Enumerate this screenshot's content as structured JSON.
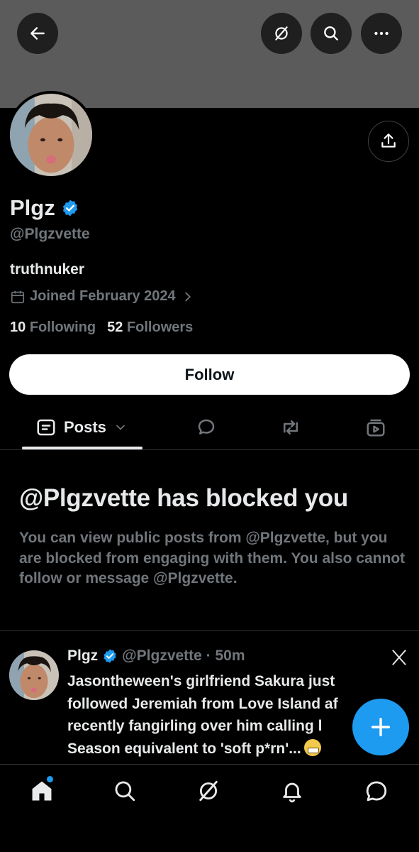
{
  "profile": {
    "name": "Plgz",
    "handle": "@Plgzvette",
    "bio": "truthnuker",
    "joined": "Joined February 2024",
    "following_count": "10",
    "following_label": "Following",
    "followers_count": "52",
    "followers_label": "Followers",
    "follow_label": "Follow"
  },
  "tabs": {
    "posts_label": "Posts"
  },
  "blocked": {
    "title": "@Plgzvette has blocked you",
    "description": "You can view public posts from @Plgzvette, but you are blocked from engaging with them. You also cannot follow or message @Plgzvette."
  },
  "post": {
    "author": "Plgz",
    "meta": "@Plgzvette · 50m",
    "text": "Jasontheween's girlfriend Sakura just\nfollowed Jeremiah from Love Island af\nrecently fangirling over him calling l\nSeason equivalent to 'soft p*rn'..."
  },
  "colors": {
    "accent": "#1d9bf0",
    "background": "#000000",
    "banner": "#5b5b5b",
    "muted_text": "#71767b",
    "primary_text": "#e7e9ea"
  },
  "icons": {
    "back": "arrow-left-icon",
    "grok": "grok-icon",
    "search": "search-icon",
    "more": "more-icon",
    "share": "share-icon",
    "calendar": "calendar-icon",
    "chevron": "chevron-right-icon",
    "posts_tab": "posts-tab-icon",
    "replies_tab": "reply-tab-icon",
    "reposts_tab": "repost-tab-icon",
    "media_tab": "media-tab-icon",
    "x_logo": "x-logo-icon",
    "compose": "plus-icon",
    "nav_home": "home-icon",
    "nav_search": "search-icon",
    "nav_grok": "grok-icon",
    "nav_notifications": "bell-icon",
    "nav_messages": "message-icon"
  }
}
